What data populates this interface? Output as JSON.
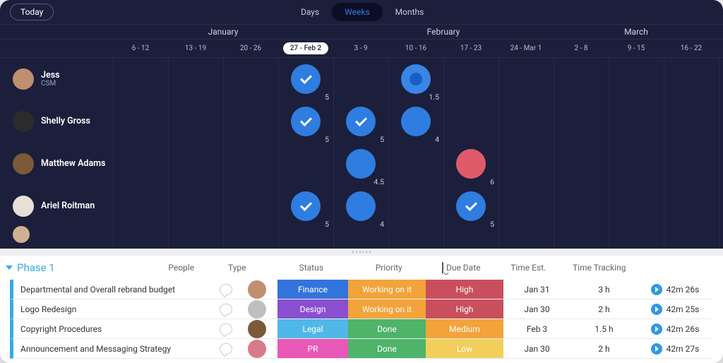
{
  "toolbar": {
    "today": "Today",
    "seg": [
      "Days",
      "Weeks",
      "Months"
    ],
    "active": 1
  },
  "months": [
    {
      "label": "January",
      "span": 4
    },
    {
      "label": "February",
      "span": 4
    },
    {
      "label": "March",
      "span": 3
    }
  ],
  "weeks": [
    "6 - 12",
    "13 - 19",
    "20 - 26",
    "27 - Feb 2",
    "3 - 9",
    "10 - 16",
    "17 - 23",
    "24 - Mar 1",
    "2 - 8",
    "9 - 15",
    "16 - 22"
  ],
  "activeWeek": 3,
  "people": [
    {
      "name": "Jess",
      "role": "CSM",
      "av": "#c08f6f",
      "cells": {
        "3": {
          "c": "blue",
          "check": true,
          "n": "5"
        },
        "5": {
          "c": "blue",
          "dot": true,
          "n": "1.5"
        }
      }
    },
    {
      "name": "Shelly Gross",
      "av": "#2b2b2b",
      "cells": {
        "3": {
          "c": "blue",
          "check": true,
          "n": "5"
        },
        "4": {
          "c": "blue",
          "check": true,
          "n": "5"
        },
        "5": {
          "c": "blue",
          "n": "4"
        }
      }
    },
    {
      "name": "Matthew Adams",
      "av": "#7a5a3a",
      "cells": {
        "4": {
          "c": "blue",
          "n": "4.5"
        },
        "6": {
          "c": "red",
          "n": "6"
        }
      }
    },
    {
      "name": "Ariel Roitman",
      "av": "#e6e0d6",
      "cells": {
        "3": {
          "c": "blue",
          "check": true,
          "n": "5"
        },
        "4": {
          "c": "blue",
          "n": "4"
        },
        "6": {
          "c": "blue",
          "check": true,
          "n": "5"
        }
      }
    }
  ],
  "sheet": {
    "title": "Phase 1",
    "columns": [
      "People",
      "Type",
      "Status",
      "Priority",
      "Due Date",
      "Time Est.",
      "Time Tracking"
    ],
    "rows": [
      {
        "bar": "#3aa8e8",
        "name": "Departmental and Overall rebrand budget",
        "av": "#c08f6f",
        "type": {
          "t": "Finance",
          "c": "#3273dc"
        },
        "status": {
          "t": "Working on it",
          "c": "#f2a33a"
        },
        "prio": {
          "t": "High",
          "c": "#c94f5d"
        },
        "due": "Jan 31",
        "est": "3 h",
        "track": "42m 26s"
      },
      {
        "bar": "#3aa8e8",
        "name": "Logo Redesign",
        "av": "#bfbfbf",
        "type": {
          "t": "Design",
          "c": "#8a4fd0"
        },
        "status": {
          "t": "Working on it",
          "c": "#f2a33a"
        },
        "prio": {
          "t": "High",
          "c": "#c94f5d"
        },
        "due": "Jan 30",
        "est": "2 h",
        "track": "42m 25s"
      },
      {
        "bar": "#3aa8e8",
        "name": "Copyright Procedures",
        "av": "#7a5a3a",
        "type": {
          "t": "Legal",
          "c": "#4fb8e8"
        },
        "status": {
          "t": "Done",
          "c": "#4fb36a"
        },
        "prio": {
          "t": "Medium",
          "c": "#f2a33a"
        },
        "due": "Feb 3",
        "est": "1.5 h",
        "track": "42m 26s"
      },
      {
        "bar": "#3aa8e8",
        "name": "Announcement and Messaging Strategy",
        "av": "#d87a8a",
        "type": {
          "t": "PR",
          "c": "#e858b5"
        },
        "status": {
          "t": "Done",
          "c": "#4fb36a"
        },
        "prio": {
          "t": "Low",
          "c": "#f2cf5b"
        },
        "due": "Jan 30",
        "est": "2 h",
        "track": "42m 27s"
      }
    ]
  }
}
